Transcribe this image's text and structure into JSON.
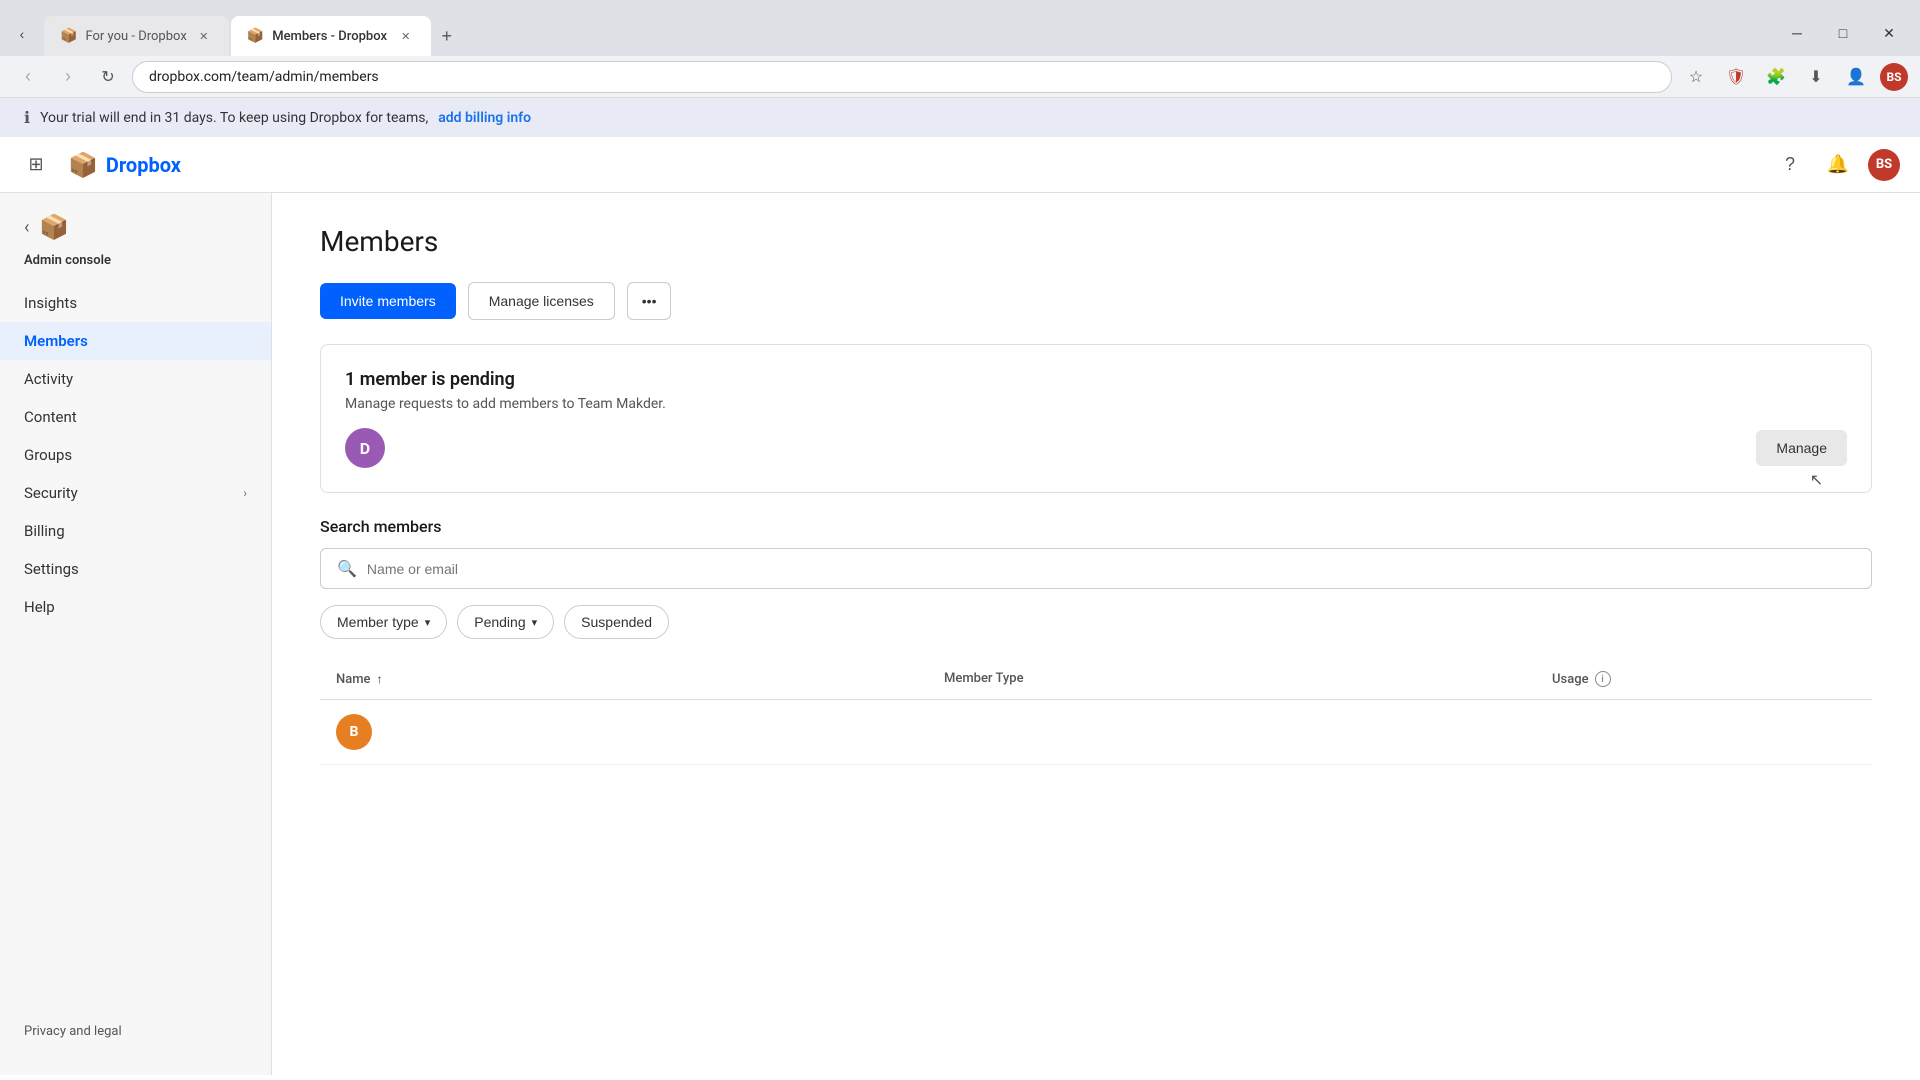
{
  "browser": {
    "tabs": [
      {
        "id": "tab1",
        "label": "For you - Dropbox",
        "active": false,
        "favicon": "📦"
      },
      {
        "id": "tab2",
        "label": "Members - Dropbox",
        "active": true,
        "favicon": "📦"
      }
    ],
    "new_tab_label": "+",
    "address": "dropbox.com/team/admin/members",
    "window_controls": [
      "─",
      "□",
      "✕"
    ]
  },
  "address_bar": {
    "back_disabled": true,
    "forward_disabled": true
  },
  "notification_banner": {
    "icon": "ℹ",
    "text": "Your trial will end in 31 days. To keep using Dropbox for teams,",
    "link_text": "add billing info"
  },
  "app_header": {
    "logo_text": "Dropbox",
    "user_initials": "BS"
  },
  "sidebar": {
    "admin_console_label": "Admin console",
    "items": [
      {
        "id": "insights",
        "label": "Insights",
        "active": false
      },
      {
        "id": "members",
        "label": "Members",
        "active": true
      },
      {
        "id": "activity",
        "label": "Activity",
        "active": false
      },
      {
        "id": "content",
        "label": "Content",
        "active": false
      },
      {
        "id": "groups",
        "label": "Groups",
        "active": false
      },
      {
        "id": "security",
        "label": "Security",
        "active": false,
        "has_chevron": true
      },
      {
        "id": "billing",
        "label": "Billing",
        "active": false
      },
      {
        "id": "settings",
        "label": "Settings",
        "active": false
      },
      {
        "id": "help",
        "label": "Help",
        "active": false
      }
    ],
    "footer": {
      "privacy_legal": "Privacy and legal"
    }
  },
  "main": {
    "page_title": "Members",
    "actions": {
      "invite_members": "Invite members",
      "manage_licenses": "Manage licenses",
      "more": "•••"
    },
    "pending_banner": {
      "title": "1 member is pending",
      "description": "Manage requests to add members to Team Makder.",
      "avatar_letter": "D",
      "manage_btn": "Manage"
    },
    "search": {
      "label": "Search members",
      "placeholder": "Name or email"
    },
    "filters": [
      {
        "id": "member-type",
        "label": "Member type",
        "has_chevron": true
      },
      {
        "id": "pending",
        "label": "Pending",
        "has_chevron": true
      },
      {
        "id": "suspended",
        "label": "Suspended",
        "has_chevron": false
      }
    ],
    "table": {
      "columns": [
        {
          "id": "name",
          "label": "Name",
          "sortable": true
        },
        {
          "id": "member-type",
          "label": "Member Type",
          "sortable": false
        },
        {
          "id": "usage",
          "label": "Usage",
          "has_info": true
        }
      ]
    },
    "table_row_avatar_letter": "B",
    "cursor_tooltip": "Manage"
  }
}
